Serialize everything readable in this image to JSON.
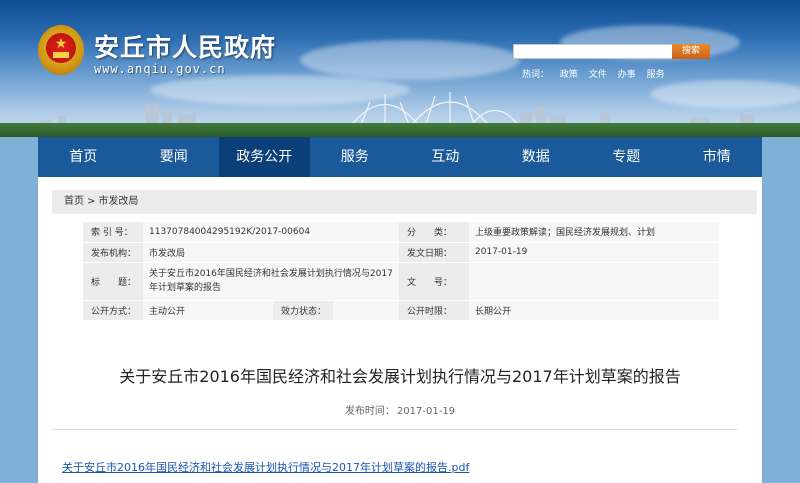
{
  "header": {
    "site_title": "安丘市人民政府",
    "site_url": "www.anqiu.gov.cn",
    "search_button": "搜索",
    "search_placeholder": "",
    "hotwords_label": "热词：",
    "hotwords": [
      "政策",
      "文件",
      "办事",
      "服务"
    ]
  },
  "nav": {
    "items": [
      "首页",
      "要闻",
      "政务公开",
      "服务",
      "互动",
      "数据",
      "专题",
      "市情"
    ],
    "active_index": 2
  },
  "breadcrumb": {
    "home": "首页",
    "separator": ">",
    "current": "市发改局"
  },
  "meta": {
    "index_no_label": "索 引 号：",
    "index_no": "11370784004295192K/2017-00604",
    "category_label": "分　　类：",
    "category": "上级重要政策解读；国民经济发展规划、计划",
    "publisher_label": "发布机构：",
    "publisher": "市发改局",
    "issue_date_label": "发文日期：",
    "issue_date": "2017-01-19",
    "title_label": "标　　题：",
    "title_value": "关于安丘市2016年国民经济和社会发展计划执行情况与2017年计划草案的报告",
    "doc_no_label": "文　　号：",
    "doc_no": "",
    "open_mode_label": "公开方式：",
    "open_mode": "主动公开",
    "validity_label": "效力状态：",
    "validity": "",
    "open_time_label": "公开时限：",
    "open_time": "长期公开"
  },
  "document": {
    "title": "关于安丘市2016年国民经济和社会发展计划执行情况与2017年计划草案的报告",
    "publish_label": "发布时间：",
    "publish_date": "2017-01-19",
    "attachment": "关于安丘市2016年国民经济和社会发展计划执行情况与2017年计划草案的报告.pdf"
  },
  "colors": {
    "nav_bg": "#1b5a9a",
    "nav_active": "#0b3f78",
    "search_button": "#d8721f",
    "link": "#1a55b0"
  }
}
